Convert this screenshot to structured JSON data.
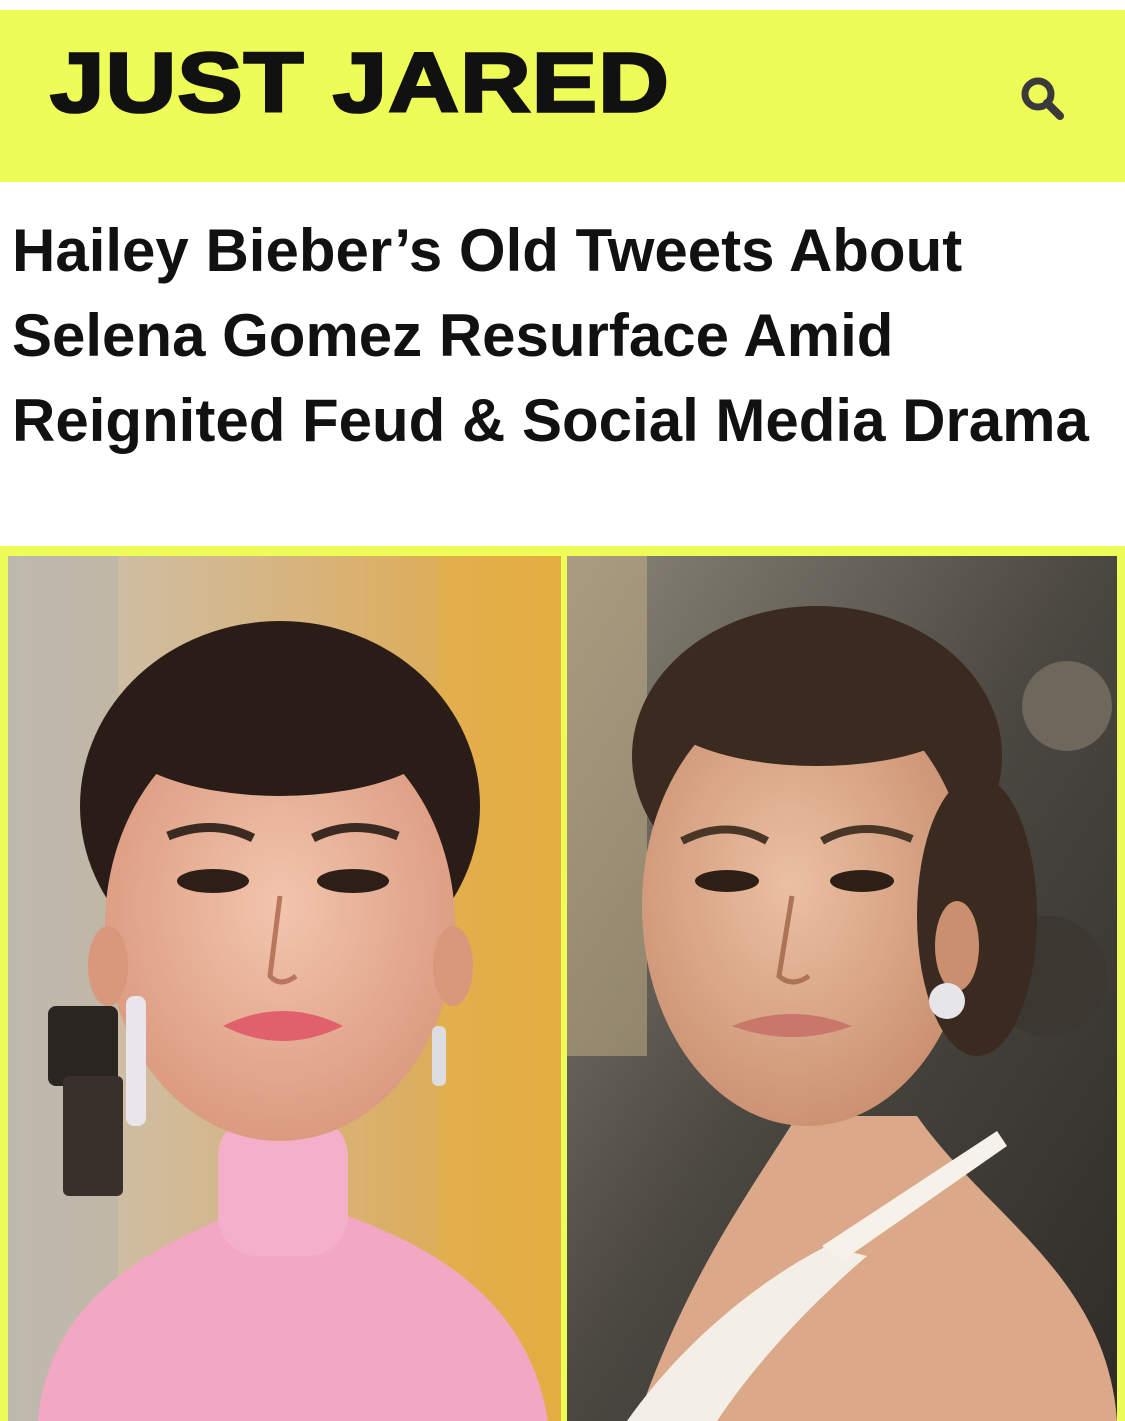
{
  "header": {
    "logo_text": "JUST JARED",
    "background_color": "#eefc58",
    "search_icon": "search-icon"
  },
  "article": {
    "headline": "Hailey Bieber’s Old Tweets About Selena Gomez Resurface Amid Reignited Feud & Social Media Drama"
  },
  "photos": {
    "left_alt": "Selena Gomez portrait",
    "right_alt": "Hailey Bieber portrait"
  }
}
